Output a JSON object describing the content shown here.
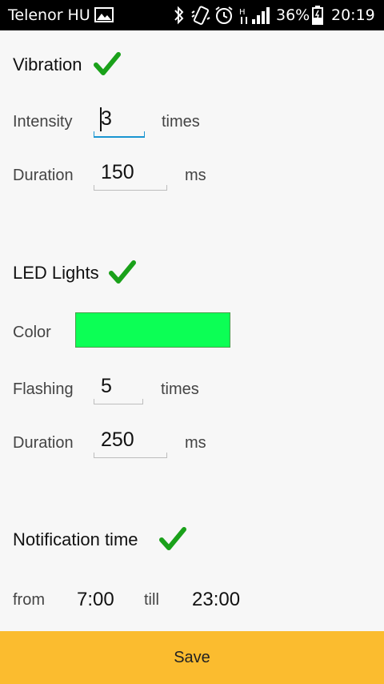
{
  "status_bar": {
    "carrier": "Telenor HU",
    "battery": "36%",
    "time": "20:19",
    "icons": [
      "gallery-icon",
      "bluetooth-icon",
      "vibrate-icon",
      "alarm-icon",
      "hspa-icon",
      "signal-icon",
      "battery-icon"
    ]
  },
  "vibration": {
    "title": "Vibration",
    "enabled": true,
    "intensity_label": "Intensity",
    "intensity_value": "3",
    "intensity_unit": "times",
    "duration_label": "Duration",
    "duration_value": "150",
    "duration_unit": "ms"
  },
  "led": {
    "title": "LED Lights",
    "enabled": true,
    "color_label": "Color",
    "color": "#0cff55",
    "flashing_label": "Flashing",
    "flashing_value": "5",
    "flashing_unit": "times",
    "duration_label": "Duration",
    "duration_value": "250",
    "duration_unit": "ms"
  },
  "notification_time": {
    "title": "Notification time",
    "enabled": true,
    "from_label": "from",
    "from_value": "7:00",
    "till_label": "till",
    "till_value": "23:00"
  },
  "save_label": "Save",
  "colors": {
    "accent": "#fbbc2f",
    "check": "#1aa11a",
    "focus": "#1a95d1"
  }
}
